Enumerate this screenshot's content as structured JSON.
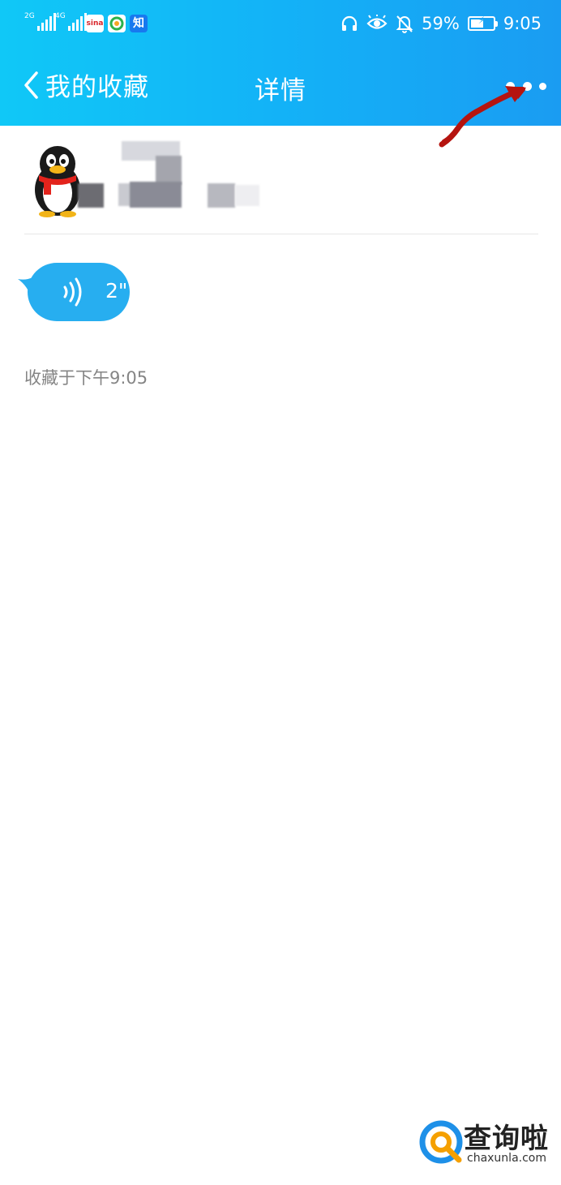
{
  "status_bar": {
    "signal_1_tag": "2G",
    "signal_2_tag": "4G",
    "app_icons": [
      "sina-icon",
      "photo-app-icon",
      "zhihu-icon"
    ],
    "app_icon_labels": [
      "sina",
      "",
      "知"
    ],
    "right_icons": [
      "headphones-icon",
      "eye-icon",
      "bell-off-icon"
    ],
    "battery_percent": "59%",
    "battery_level": 0.59,
    "time": "9:05"
  },
  "navbar": {
    "back_label": "我的收藏",
    "title": "详情",
    "more_icon": "more-icon"
  },
  "sender": {
    "avatar_icon": "qq-penguin-avatar"
  },
  "voice_message": {
    "icon": "voice-wave-icon",
    "duration": "2\""
  },
  "saved_time": "收藏于下午9:05",
  "watermark": {
    "brand": "查询啦",
    "url": "chaxunla.com"
  },
  "colors": {
    "header_start": "#10c8f7",
    "header_end": "#1a9cf2",
    "voice_bubble": "#27aef0",
    "annotation": "#b5140f"
  }
}
